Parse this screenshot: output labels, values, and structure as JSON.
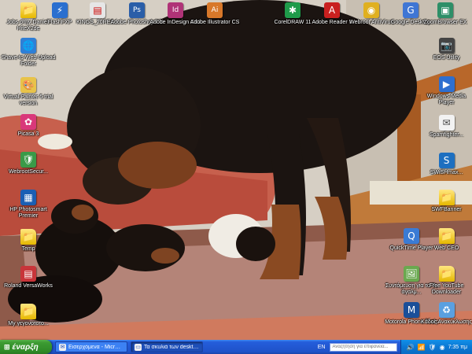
{
  "desktop": {
    "icons_left": [
      {
        "label": "Jobs στην Daniel-HiteX2de",
        "glyph": "📁",
        "type": "folder"
      },
      {
        "label": "Shave-to-Web Upload Folder",
        "glyph": "🌐",
        "type": "app"
      },
      {
        "label": "Virtual Painter 5 trial version",
        "glyph": "🎨",
        "type": "app"
      },
      {
        "label": "Picasa 3",
        "glyph": "✿",
        "type": "app"
      },
      {
        "label": "WebrootSecur...",
        "glyph": "🛡",
        "type": "app"
      },
      {
        "label": "HP Photosmart Premier",
        "glyph": "▦",
        "type": "app"
      },
      {
        "label": "Temp",
        "glyph": "📁",
        "type": "folder"
      },
      {
        "label": "Roland VersaWorks",
        "glyph": "▤",
        "type": "app"
      },
      {
        "label": "My γεγονοτοτο...",
        "glyph": "📁",
        "type": "folder"
      }
    ],
    "icons_top": [
      {
        "label": "FlashFXP",
        "glyph": "⚡",
        "type": "app"
      },
      {
        "label": "KINGS_20RES...",
        "glyph": "▤",
        "type": "app"
      },
      {
        "label": "Adobe Photoshop CS",
        "glyph": "Ps",
        "type": "app"
      },
      {
        "label": "Adobe InDesign CS2",
        "glyph": "Id",
        "type": "app"
      },
      {
        "label": "Adobe Illustrator CS",
        "glyph": "Ai",
        "type": "app"
      },
      {
        "label": "CorelDRAW 11",
        "glyph": "✱",
        "type": "app"
      },
      {
        "label": "Adobe Reader 8",
        "glyph": "A",
        "type": "app"
      },
      {
        "label": "Webroot AntiVirus",
        "glyph": "◉",
        "type": "app"
      },
      {
        "label": "Google Desktop",
        "glyph": "G",
        "type": "app"
      },
      {
        "label": "ZoomBrowser EX",
        "glyph": "▣",
        "type": "app"
      }
    ],
    "icons_right": [
      {
        "label": "EOS Utility",
        "glyph": "📷",
        "type": "app"
      },
      {
        "label": "Windows Media Player",
        "glyph": "▶",
        "type": "app"
      },
      {
        "label": "Spamfighter...",
        "glyph": "✉",
        "type": "app"
      },
      {
        "label": "SWiSHmax...",
        "glyph": "S",
        "type": "app"
      },
      {
        "label": "SWFBanner",
        "glyph": "📁",
        "type": "folder"
      },
      {
        "label": "QuickTime Player",
        "glyph": "Q",
        "type": "app"
      },
      {
        "label": "Web CEO",
        "glyph": "📁",
        "type": "folder"
      },
      {
        "label": "Συντόμευση για το Το άγαλμ...",
        "glyph": "🖼",
        "type": "app"
      },
      {
        "label": "Free YouTube Downloader",
        "glyph": "📁",
        "type": "folder"
      },
      {
        "label": "Motorola Phone Tools",
        "glyph": "M",
        "type": "app"
      },
      {
        "label": "Κάδος Ανακύκλωσης",
        "glyph": "♻",
        "type": "app"
      }
    ]
  },
  "taskbar": {
    "start_label": "έναρξη",
    "start_flag": "⊞",
    "tasks": [
      {
        "label": "Εισερχόμενα - Micros...",
        "glyph": "✉",
        "active": false
      },
      {
        "label": "Τα σκυλιά των deskto...",
        "glyph": "▭",
        "active": true
      }
    ],
    "language": "EN",
    "search_placeholder": "Αναζήτηση για επιφάνεια...",
    "clock": "7:35 πμ",
    "tray_icons": [
      "🔊",
      "📶",
      "🛡",
      "◉"
    ]
  },
  "colors": {
    "taskbar_blue": "#245edb",
    "start_green": "#3c9b32",
    "tray_blue": "#0b77d3"
  }
}
